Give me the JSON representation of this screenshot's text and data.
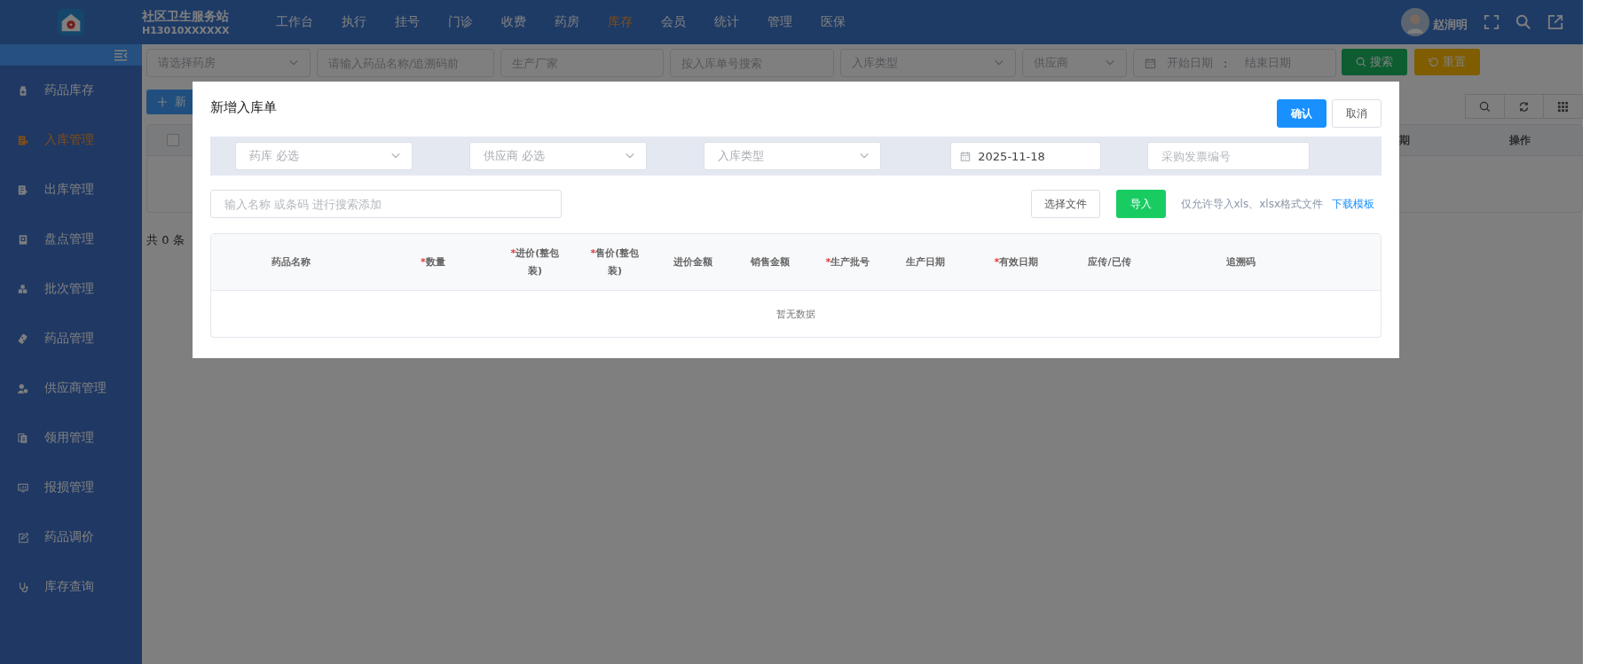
{
  "header": {
    "site_title": "社区卫生服务站",
    "site_code": "H13010XXXXXX",
    "nav": [
      {
        "label": "工作台",
        "selected": false
      },
      {
        "label": "执行",
        "selected": false
      },
      {
        "label": "挂号",
        "selected": false
      },
      {
        "label": "门诊",
        "selected": false
      },
      {
        "label": "收费",
        "selected": false
      },
      {
        "label": "药房",
        "selected": false
      },
      {
        "label": "库存",
        "selected": true
      },
      {
        "label": "会员",
        "selected": false
      },
      {
        "label": "统计",
        "selected": false
      },
      {
        "label": "管理",
        "selected": false
      },
      {
        "label": "医保",
        "selected": false
      }
    ],
    "user": {
      "name": "赵润明"
    }
  },
  "sidebar": {
    "items": [
      {
        "label": "药品库存",
        "selected": false
      },
      {
        "label": "入库管理",
        "selected": true
      },
      {
        "label": "出库管理",
        "selected": false
      },
      {
        "label": "盘点管理",
        "selected": false
      },
      {
        "label": "批次管理",
        "selected": false
      },
      {
        "label": "药品管理",
        "selected": false
      },
      {
        "label": "供应商管理",
        "selected": false
      },
      {
        "label": "领用管理",
        "selected": false
      },
      {
        "label": "报损管理",
        "selected": false
      },
      {
        "label": "药品调价",
        "selected": false
      },
      {
        "label": "库存查询",
        "selected": false
      }
    ]
  },
  "filters": [
    {
      "kind": "select",
      "placeholder": "请选择药房"
    },
    {
      "kind": "input",
      "placeholder": "请输入药品名称/追溯码前"
    },
    {
      "kind": "input",
      "placeholder": "生产厂家"
    },
    {
      "kind": "input",
      "placeholder": "按入库单号搜索"
    },
    {
      "kind": "select",
      "placeholder": "入库类型"
    },
    {
      "kind": "select",
      "placeholder": "供应商"
    },
    {
      "kind": "daterange",
      "start_placeholder": "开始日期",
      "separator": ":",
      "end_placeholder": "结束日期"
    }
  ],
  "filter_buttons": [
    {
      "kind": "search",
      "label": "搜索"
    },
    {
      "kind": "reset",
      "label": "重置"
    }
  ],
  "add_button": {
    "label": "新"
  },
  "table": {
    "checked": false,
    "columns": [
      {
        "label": "期"
      },
      {
        "label": "操作"
      }
    ]
  },
  "total": "共 0 条",
  "modal": {
    "title": "新增入库单",
    "buttons": [
      {
        "kind": "primary",
        "label": "确认"
      },
      {
        "kind": "default",
        "label": "取消"
      }
    ],
    "fields": [
      {
        "kind": "select",
        "placeholder": "药库 必选"
      },
      {
        "kind": "select",
        "placeholder": "供应商 必选"
      },
      {
        "kind": "select",
        "placeholder": "入库类型"
      },
      {
        "kind": "date",
        "value": "2025-11-18"
      },
      {
        "kind": "input",
        "placeholder": "采购发票编号"
      }
    ],
    "search": {
      "placeholder": "输入名称 或条码 进行搜索添加"
    },
    "file_button": "选择文件",
    "import_button": "导入",
    "note": "仅允许导入xls、xlsx格式文件",
    "link": "下载模板",
    "columns": [
      {
        "label": "药品名称"
      },
      {
        "mark": "*",
        "label": "数量"
      },
      {
        "mark": "*",
        "label": "进价(整包装)"
      },
      {
        "mark": "*",
        "label": "售价(整包装)"
      },
      {
        "label": "进价金额"
      },
      {
        "label": "销售金额"
      },
      {
        "mark": "*",
        "label": "生产批号"
      },
      {
        "label": "生产日期"
      },
      {
        "mark": "*",
        "label": "有效日期"
      },
      {
        "label": "应传/已传"
      },
      {
        "label": "追溯码"
      }
    ],
    "empty_text": "暂无数据"
  }
}
